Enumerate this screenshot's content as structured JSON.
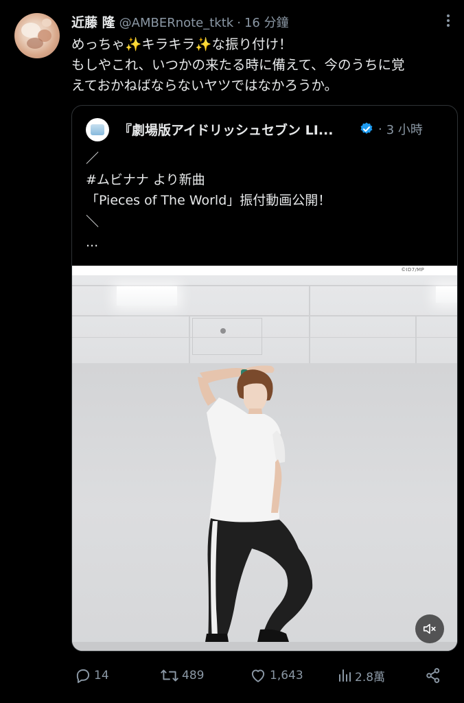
{
  "tweet": {
    "display_name": "近藤 隆",
    "handle": "@AMBERnote_tktk",
    "separator": "·",
    "time": "16 分鐘",
    "text_lines": [
      "めっちゃ✨キラキラ✨な振り付け！",
      "もしやこれ、いつかの来たる時に備えて、今のうちに覚",
      "えておかねばならないヤツではなかろうか。"
    ]
  },
  "quote": {
    "display_name": "『劇場版アイドリッシュセブン LI...",
    "separator": "·",
    "time": "3 小時",
    "text_lines": [
      "／",
      "#ムビナナ より新曲",
      "「Pieces of The World」振付動画公開！",
      "＼",
      "..."
    ],
    "video": {
      "copyright": "©ID7/MP"
    }
  },
  "actions": {
    "reply_count": "14",
    "retweet_count": "489",
    "like_count": "1,643",
    "view_count": "2.8萬"
  },
  "icons": {
    "more": "more-icon",
    "verified": "verified-icon",
    "mute": "mute-icon",
    "reply": "reply-icon",
    "retweet": "retweet-icon",
    "like": "like-icon",
    "views": "views-icon",
    "share": "share-icon"
  },
  "colors": {
    "background": "#000000",
    "text": "#e7e9ea",
    "secondary": "#8b98a5",
    "verified": "#1d9bf0",
    "border": "#2f3336"
  }
}
